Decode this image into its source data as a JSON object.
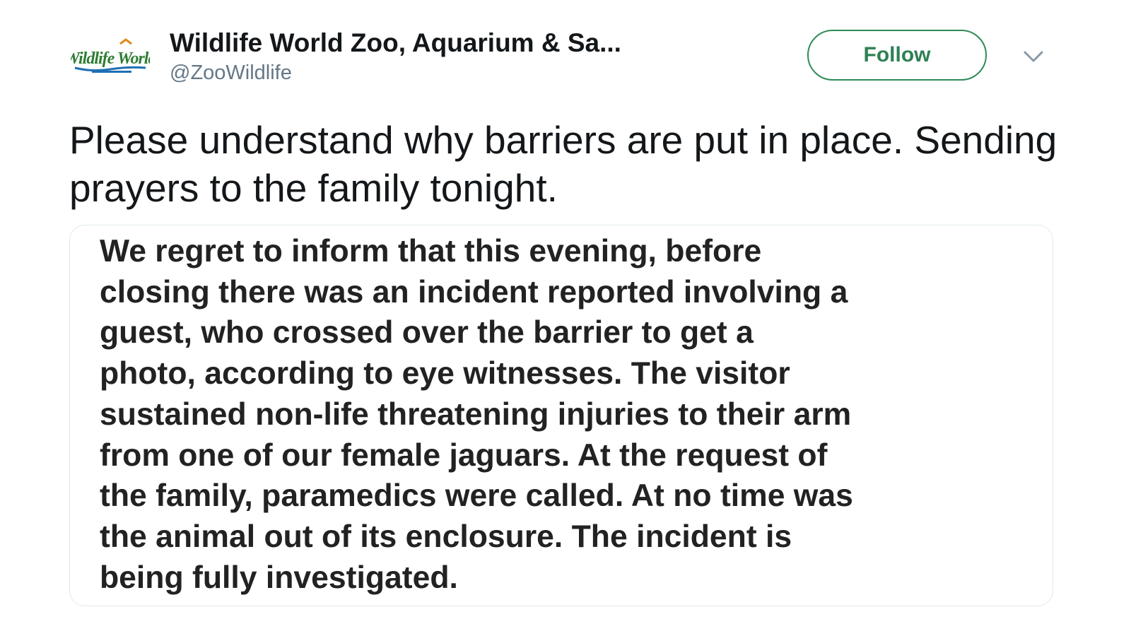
{
  "tweet": {
    "author": {
      "display_name": "Wildlife World Zoo, Aquarium & Sa...",
      "handle": "@ZooWildlife",
      "avatar_text": "Wildlife World"
    },
    "follow_label": "Follow",
    "text": "Please understand why barriers are put in place. Sending prayers to the family tonight.",
    "attached_image_text": "We regret to inform that this evening, before\nclosing there was an incident reported involving a\nguest, who crossed over the barrier to get a\nphoto, according to eye witnesses. The visitor\nsustained non-life threatening injuries to their arm\nfrom one of our female jaguars. At the request of\nthe family, paramedics were called. At no time was\nthe animal out of its enclosure.  The incident is\nbeing fully investigated.",
    "colors": {
      "follow_border": "#2e8b57",
      "follow_text": "#2f7f54",
      "handle": "#657786",
      "logo_green": "#2e7d32",
      "logo_blue": "#1f6fb2",
      "logo_orange": "#e08a1e"
    },
    "icons": {
      "more": "chevron-down-icon",
      "avatar": "wildlife-world-logo"
    }
  }
}
